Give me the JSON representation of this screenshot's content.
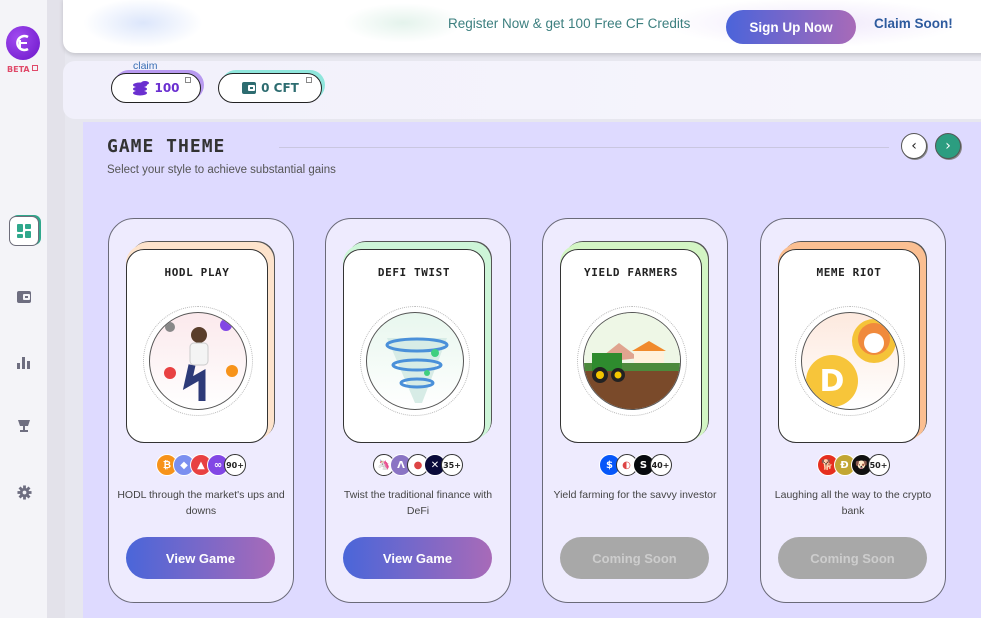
{
  "sidebar": {
    "logo": "CF",
    "beta_label": "BETA",
    "items": [
      {
        "icon": "dashboard-icon",
        "active": true
      },
      {
        "icon": "wallet-icon",
        "active": false
      },
      {
        "icon": "bar-chart-icon",
        "active": false
      },
      {
        "icon": "trophy-icon",
        "active": false
      },
      {
        "icon": "gear-icon",
        "active": false
      }
    ]
  },
  "banner": {
    "register_text": "Register Now & get 100 Free CF Credits",
    "signup_label": "Sign Up Now",
    "claim_soon": "Claim Soon!"
  },
  "wallet": {
    "claim_label": "claim",
    "credits_value": "100",
    "cft_value": "0 CFT"
  },
  "section": {
    "title": "GAME THEME",
    "subtitle": "Select your style to achieve substantial gains",
    "prev_icon": "‹",
    "next_icon": "›"
  },
  "games": [
    {
      "title": "HODL PLAY",
      "accent": "#fde3cc",
      "art_bg": "#fbe9ec",
      "coins": [
        {
          "name": "bitcoin",
          "color": "#f7931a",
          "glyph": "₿"
        },
        {
          "name": "ethereum",
          "color": "#7b8ff0",
          "glyph": "◆"
        },
        {
          "name": "avalanche",
          "color": "#e84142",
          "glyph": "▲"
        },
        {
          "name": "polygon",
          "color": "#8247e5",
          "glyph": "∞"
        }
      ],
      "count": "90+",
      "description": "HODL through the market's ups and downs",
      "button": "View Game",
      "button_state": "active"
    },
    {
      "title": "DEFI TWIST",
      "accent": "#cdf5d8",
      "art_bg": "#e8f7ee",
      "coins": [
        {
          "name": "uniswap",
          "color": "#ffffff",
          "glyph": "🦄"
        },
        {
          "name": "aave",
          "color": "#8a74c4",
          "glyph": "Λ"
        },
        {
          "name": "pancakeswap",
          "color": "#ffffff",
          "glyph": "●"
        },
        {
          "name": "synthetix",
          "color": "#0a0a3a",
          "glyph": "✕"
        }
      ],
      "count": "35+",
      "description": "Twist the traditional finance with DeFi",
      "button": "View Game",
      "button_state": "active"
    },
    {
      "title": "YIELD FARMERS",
      "accent": "#d3f5c4",
      "art_bg": "#eef6e6",
      "coins": [
        {
          "name": "yearn",
          "color": "#0657f9",
          "glyph": "$"
        },
        {
          "name": "curve",
          "color": "#ffffff",
          "glyph": "◐"
        },
        {
          "name": "compound",
          "color": "#070a0e",
          "glyph": "S"
        }
      ],
      "count": "40+",
      "description": "Yield farming for the savvy investor",
      "button": "Coming Soon",
      "button_state": "disabled"
    },
    {
      "title": "MEME RIOT",
      "accent": "#fbbf92",
      "art_bg": "#fde9de",
      "coins": [
        {
          "name": "shiba-inu",
          "color": "#e62f1f",
          "glyph": "🐕"
        },
        {
          "name": "dogecoin",
          "color": "#c2a633",
          "glyph": "Ð"
        },
        {
          "name": "floki",
          "color": "#111111",
          "glyph": "🐶"
        }
      ],
      "count": "50+",
      "description": "Laughing all the way to the crypto bank",
      "button": "Coming Soon",
      "button_state": "disabled"
    }
  ]
}
